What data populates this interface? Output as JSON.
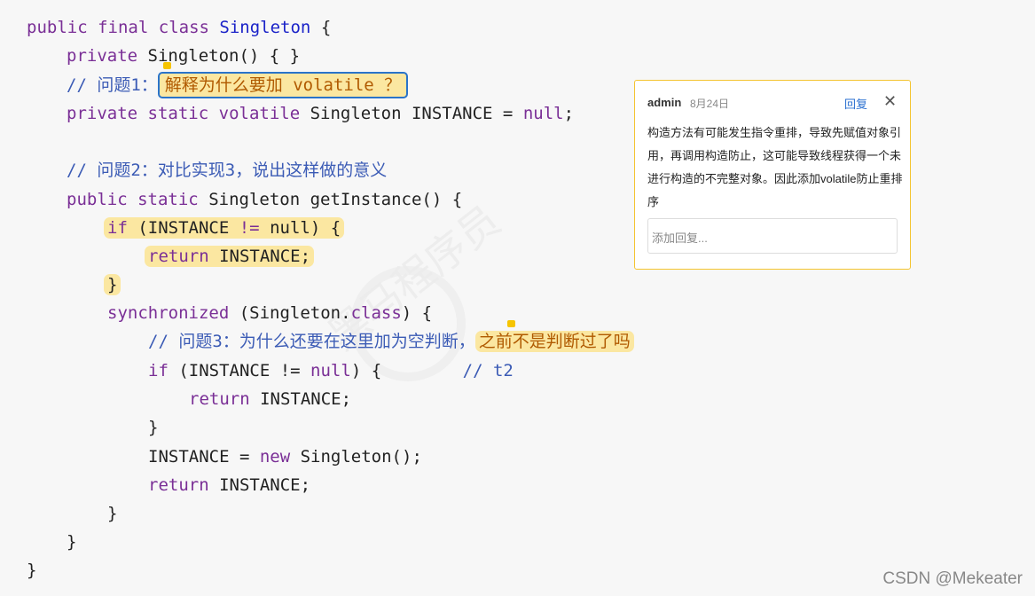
{
  "code": {
    "l1": [
      "public",
      "final",
      "class",
      "Singleton",
      "{"
    ],
    "l2": [
      "private",
      "Singleton() { }"
    ],
    "l3_comment": "// 问题1：",
    "l3_highlight": "解释为什么要加 volatile ？",
    "l4": [
      "private",
      "static",
      "volatile",
      "Singleton INSTANCE =",
      "null",
      ";"
    ],
    "l5_comment": "// 问题2：对比实现3，说出这样做的意义",
    "l6": [
      "public",
      "static",
      "Singleton getInstance() {"
    ],
    "l7": [
      "if",
      " (INSTANCE ",
      "!=",
      " null) {"
    ],
    "l8": [
      "return",
      " INSTANCE;"
    ],
    "l9": "}",
    "l10": [
      "synchronized",
      " (Singleton.",
      "class",
      ") {"
    ],
    "l11_comment": "// 问题3：为什么还要在这里加为空判断，",
    "l11_highlight": "之前不是判断过了吗",
    "l12": [
      "if",
      " (INSTANCE != ",
      "null",
      ") {",
      "// t2"
    ],
    "l13": [
      "return",
      " INSTANCE;"
    ],
    "l14": "}",
    "l15": [
      "INSTANCE = ",
      "new",
      " Singleton();"
    ],
    "l16": [
      "return",
      " INSTANCE;"
    ],
    "l17": "}",
    "l18": "}",
    "l19": "}"
  },
  "comment_panel": {
    "user": "admin",
    "date": "8月24日",
    "reply_label": "回复",
    "close_label": "✕",
    "body": "构造方法有可能发生指令重排，导致先赋值对象引用，再调用构造防止，这可能导致线程获得一个未进行构造的不完整对象。因此添加volatile防止重排序",
    "reply_placeholder": "添加回复..."
  },
  "watermark": "黑马程序员",
  "credit": "CSDN @Mekeater"
}
